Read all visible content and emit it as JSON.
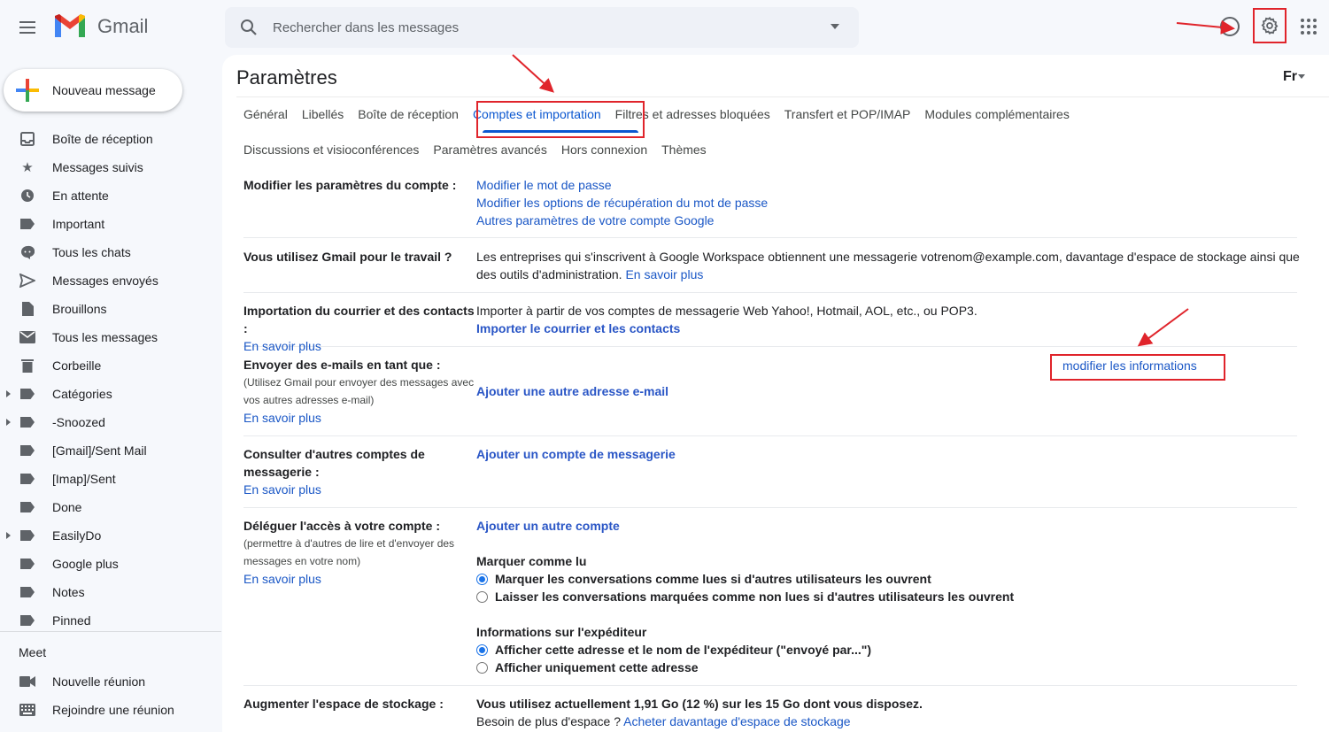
{
  "app": {
    "name": "Gmail"
  },
  "search": {
    "placeholder": "Rechercher dans les messages"
  },
  "compose": {
    "label": "Nouveau message"
  },
  "sidebar": {
    "items": [
      {
        "label": "Boîte de réception",
        "icon": "inbox-icon"
      },
      {
        "label": "Messages suivis",
        "icon": "star-icon"
      },
      {
        "label": "En attente",
        "icon": "clock-icon"
      },
      {
        "label": "Important",
        "icon": "important-icon"
      },
      {
        "label": "Tous les chats",
        "icon": "chat-icon"
      },
      {
        "label": "Messages envoyés",
        "icon": "send-icon"
      },
      {
        "label": "Brouillons",
        "icon": "draft-icon"
      },
      {
        "label": "Tous les messages",
        "icon": "mail-icon"
      },
      {
        "label": "Corbeille",
        "icon": "trash-icon"
      },
      {
        "label": "Catégories",
        "icon": "label-icon"
      },
      {
        "label": "-Snoozed",
        "icon": "label-icon"
      },
      {
        "label": "[Gmail]/Sent Mail",
        "icon": "label-icon"
      },
      {
        "label": "[Imap]/Sent",
        "icon": "label-icon"
      },
      {
        "label": "Done",
        "icon": "label-icon"
      },
      {
        "label": "EasilyDo",
        "icon": "label-icon"
      },
      {
        "label": "Google plus",
        "icon": "label-icon"
      },
      {
        "label": "Notes",
        "icon": "label-icon"
      },
      {
        "label": "Pinned",
        "icon": "label-icon"
      }
    ],
    "meet": {
      "title": "Meet",
      "items": [
        {
          "label": "Nouvelle réunion",
          "icon": "video-icon"
        },
        {
          "label": "Rejoindre une réunion",
          "icon": "keyboard-icon"
        }
      ]
    }
  },
  "settings": {
    "title": "Paramètres",
    "lang": "Fr",
    "tabs_row1": [
      "Général",
      "Libellés",
      "Boîte de réception",
      "Comptes et importation",
      "Filtres et adresses bloquées",
      "Transfert et POP/IMAP",
      "Modules complémentaires"
    ],
    "tabs_row2": [
      "Discussions et visioconférences",
      "Paramètres avancés",
      "Hors connexion",
      "Thèmes"
    ],
    "active_tab": "Comptes et importation",
    "sections": {
      "account": {
        "label": "Modifier les paramètres du compte :",
        "links": [
          "Modifier le mot de passe",
          "Modifier les options de récupération du mot de passe",
          "Autres paramètres de votre compte Google"
        ]
      },
      "work": {
        "label": "Vous utilisez Gmail pour le travail ?",
        "text": "Les entreprises qui s'inscrivent à Google Workspace obtiennent une messagerie votrenom@example.com, davantage d'espace de stockage ainsi que des outils d'administration.",
        "link": "En savoir plus"
      },
      "import": {
        "label": "Importation du courrier et des contacts :",
        "label_link": "En savoir plus",
        "text": "Importer à partir de vos comptes de messagerie Web Yahoo!, Hotmail, AOL, etc., ou POP3.",
        "action": "Importer le courrier et les contacts"
      },
      "sendas": {
        "label": "Envoyer des e-mails en tant que :",
        "note": "(Utilisez Gmail pour envoyer des messages avec vos autres adresses e-mail)",
        "label_link": "En savoir plus",
        "action": "Ajouter une autre adresse e-mail",
        "annotation": "modifier les informations"
      },
      "check": {
        "label": "Consulter d'autres comptes de messagerie :",
        "label_link": "En savoir plus",
        "action": "Ajouter un compte de messagerie"
      },
      "delegate": {
        "label": "Déléguer l'accès à votre compte :",
        "note": "(permettre à d'autres de lire et d'envoyer des messages en votre nom)",
        "label_link": "En savoir plus",
        "action": "Ajouter un autre compte",
        "mark_title": "Marquer comme lu",
        "mark_opt1": "Marquer les conversations comme lues si d'autres utilisateurs les ouvrent",
        "mark_opt2": "Laisser les conversations marquées comme non lues si d'autres utilisateurs les ouvrent",
        "sender_title": "Informations sur l'expéditeur",
        "sender_opt1": "Afficher cette adresse et le nom de l'expéditeur (\"envoyé par...\")",
        "sender_opt2": "Afficher uniquement cette adresse"
      },
      "storage": {
        "label": "Augmenter l'espace de stockage :",
        "text": "Vous utilisez actuellement 1,91 Go (12 %) sur les 15 Go dont vous disposez.",
        "text2": "Besoin de plus d'espace ?",
        "link": "Acheter davantage d'espace de stockage"
      }
    }
  },
  "colors": {
    "accent": "#0b57d0",
    "annotation": "#e0242b",
    "link": "#1a57c6"
  }
}
